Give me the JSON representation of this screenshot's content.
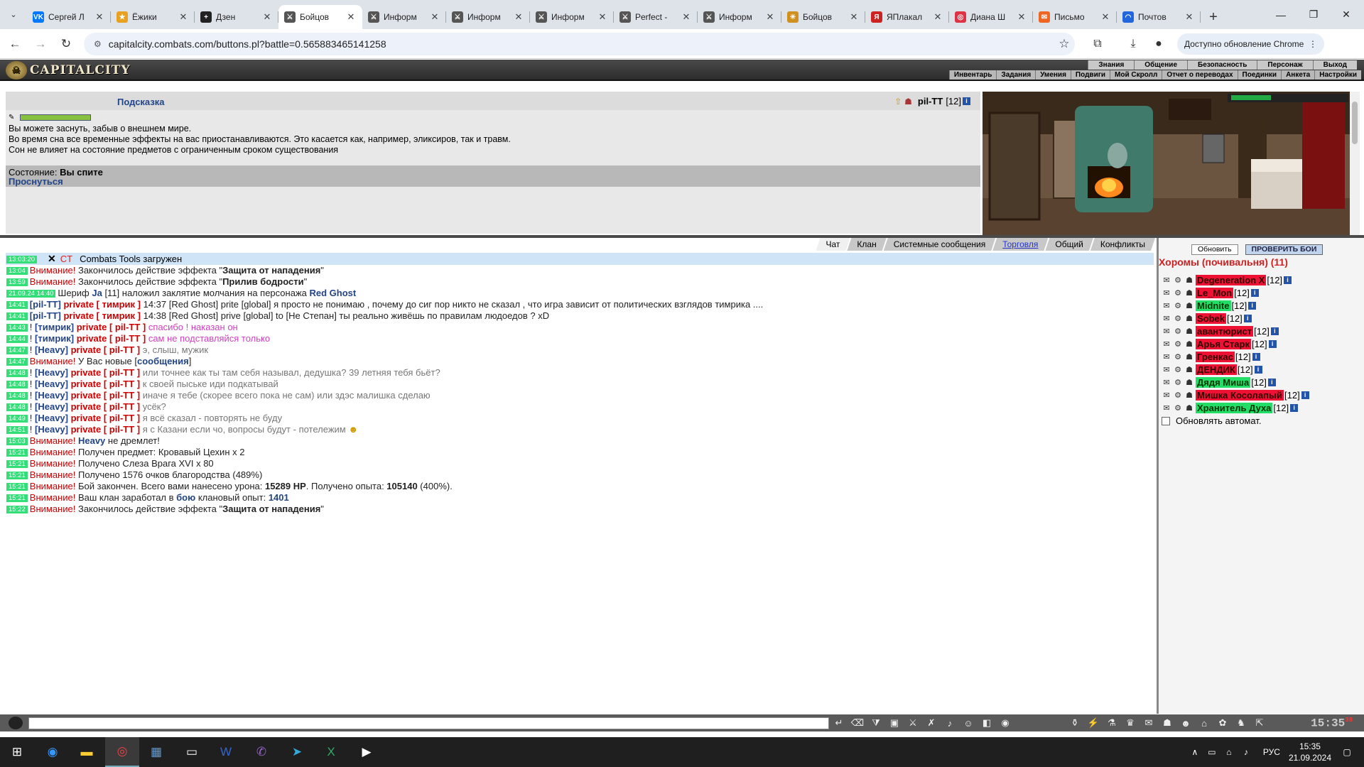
{
  "browser": {
    "tabs": [
      {
        "title": "Сергей Л",
        "icon": "VK",
        "color": "#0077ff",
        "active": false
      },
      {
        "title": "Ёжики",
        "icon": "★",
        "color": "#e8a020",
        "active": false
      },
      {
        "title": "Дзен",
        "icon": "+",
        "color": "#222222",
        "active": false
      },
      {
        "title": "Бойцов",
        "icon": "⚔",
        "color": "#555555",
        "active": true
      },
      {
        "title": "Информ",
        "icon": "⚔",
        "color": "#555555",
        "active": false
      },
      {
        "title": "Информ",
        "icon": "⚔",
        "color": "#555555",
        "active": false
      },
      {
        "title": "Информ",
        "icon": "⚔",
        "color": "#555555",
        "active": false
      },
      {
        "title": "Perfect -",
        "icon": "⚔",
        "color": "#555555",
        "active": false
      },
      {
        "title": "Информ",
        "icon": "⚔",
        "color": "#555555",
        "active": false
      },
      {
        "title": "Бойцов",
        "icon": "☀",
        "color": "#d09020",
        "active": false
      },
      {
        "title": "ЯПлакал",
        "icon": "Я",
        "color": "#cc2222",
        "active": false
      },
      {
        "title": "Диана Ш",
        "icon": "◎",
        "color": "#dd3344",
        "active": false
      },
      {
        "title": "Письмо",
        "icon": "✉",
        "color": "#ee6622",
        "active": false
      },
      {
        "title": "Почтов",
        "icon": "◠",
        "color": "#2266dd",
        "active": false
      }
    ],
    "url": "capitalcity.combats.com/buttons.pl?battle=0.565883465141258",
    "update_label": "Доступно обновление Chrome"
  },
  "game": {
    "logo_text": "CAPITALCITY",
    "nav_top": [
      "Знания",
      "Общение",
      "Безопасность",
      "Персонаж",
      "Выход"
    ],
    "nav_bottom": [
      "Инвентарь",
      "Задания",
      "Умения",
      "Подвиги",
      "Мой Скролл",
      "Отчет о переводах",
      "Поединки",
      "Анкета",
      "Настройки"
    ],
    "hint_title": "Подсказка",
    "character": {
      "name": "pil-TT",
      "level": "[12]"
    },
    "hint_lines": [
      "Вы можете заснуть, забыв о внешнем мире.",
      "Во время сна все временные эффекты на вас приостанавливаются. Это касается как, например, эликсиров, так и травм.",
      "Сон не влияет на состояние предметов с ограниченным сроком существования"
    ],
    "state_label": "Состояние:",
    "state_value": "Вы спите",
    "wake_link": "Проснуться"
  },
  "chat": {
    "tabs": [
      {
        "label": "Чат",
        "selected": true
      },
      {
        "label": "Клан",
        "selected": false
      },
      {
        "label": "Системные сообщения",
        "selected": false
      },
      {
        "label": "Торговля",
        "selected": false,
        "blue": true
      },
      {
        "label": "Общий",
        "selected": false
      },
      {
        "label": "Конфликты",
        "selected": false
      }
    ],
    "header": {
      "time": "13:03:20",
      "tag": "CT",
      "text": "Combats Tools загружен"
    },
    "lines": [
      {
        "t": "13:04",
        "parts": [
          [
            "warn",
            "Внимание! "
          ],
          [
            "dk",
            "Закончилось действие эффекта \""
          ],
          [
            "b",
            "Защита от нападения"
          ],
          [
            "dk",
            "\""
          ]
        ]
      },
      {
        "t": "13:59",
        "parts": [
          [
            "warn",
            "Внимание! "
          ],
          [
            "dk",
            "Закончилось действие эффекта \""
          ],
          [
            "b",
            "Прилив бодрости"
          ],
          [
            "dk",
            "\""
          ]
        ]
      },
      {
        "t": "21.09.24 14:40",
        "parts": [
          [
            "dk",
            "Шериф "
          ],
          [
            "nick",
            "Ja"
          ],
          [
            "dk",
            " [11] наложил заклятие молчания на персонажа "
          ],
          [
            "nick",
            "Red Ghost"
          ]
        ]
      },
      {
        "t": "14:41",
        "parts": [
          [
            "nick",
            "[pil-TT] "
          ],
          [
            "priv",
            "private [ тимрик ] "
          ],
          [
            "dk",
            "14:37 [Red Ghost] prite [global] я просто не понимаю , почему до сиг пор никто не сказал , что игра зависит от политических взглядов тимрика ...."
          ]
        ]
      },
      {
        "t": "14:41",
        "parts": [
          [
            "nick",
            "[pil-TT] "
          ],
          [
            "priv",
            "private [ тимрик ] "
          ],
          [
            "dk",
            "14:38 [Red Ghost] prive [global] to [Не Степан] ты реально живёшь по правилам людоедов ? xD"
          ]
        ]
      },
      {
        "t": "14:43",
        "parts": [
          [
            "dk",
            "! "
          ],
          [
            "nick",
            "[тимрик] "
          ],
          [
            "priv",
            "private [ pil-TT ] "
          ],
          [
            "mag",
            "спасибо ! наказан он"
          ]
        ]
      },
      {
        "t": "14:44",
        "parts": [
          [
            "dk",
            "! "
          ],
          [
            "nick",
            "[тимрик] "
          ],
          [
            "priv",
            "private [ pil-TT ] "
          ],
          [
            "mag",
            "сам не подставляйся только"
          ]
        ]
      },
      {
        "t": "14:47",
        "parts": [
          [
            "dk",
            "! "
          ],
          [
            "nick",
            "[Heavy] "
          ],
          [
            "priv",
            "private [ pil-TT ] "
          ],
          [
            "gray",
            "э, слыш, мужик"
          ]
        ]
      },
      {
        "t": "14:47",
        "parts": [
          [
            "warn",
            "Внимание! "
          ],
          [
            "dk",
            "У Вас новые ["
          ],
          [
            "nick",
            "сообщения"
          ],
          [
            "dk",
            "]"
          ]
        ]
      },
      {
        "t": "14:48",
        "parts": [
          [
            "dk",
            "! "
          ],
          [
            "nick",
            "[Heavy] "
          ],
          [
            "priv",
            "private [ pil-TT ] "
          ],
          [
            "gray",
            "или точнее как ты там себя называл, дедушка? 39 летняя тебя бьёт?"
          ]
        ]
      },
      {
        "t": "14:48",
        "parts": [
          [
            "dk",
            "! "
          ],
          [
            "nick",
            "[Heavy] "
          ],
          [
            "priv",
            "private [ pil-TT ] "
          ],
          [
            "gray",
            "к своей пыське иди подкатывай"
          ]
        ]
      },
      {
        "t": "14:48",
        "parts": [
          [
            "dk",
            "! "
          ],
          [
            "nick",
            "[Heavy] "
          ],
          [
            "priv",
            "private [ pil-TT ] "
          ],
          [
            "gray",
            "иначе я тебе (скорее всего пока не сам) или здэс малишка сделаю"
          ]
        ]
      },
      {
        "t": "14:48",
        "parts": [
          [
            "dk",
            "! "
          ],
          [
            "nick",
            "[Heavy] "
          ],
          [
            "priv",
            "private [ pil-TT ] "
          ],
          [
            "gray",
            "усёк?"
          ]
        ]
      },
      {
        "t": "14:49",
        "parts": [
          [
            "dk",
            "! "
          ],
          [
            "nick",
            "[Heavy] "
          ],
          [
            "priv",
            "private [ pil-TT ] "
          ],
          [
            "gray",
            "я всё сказал - повторять не буду"
          ]
        ]
      },
      {
        "t": "14:51",
        "parts": [
          [
            "dk",
            "! "
          ],
          [
            "nick",
            "[Heavy] "
          ],
          [
            "priv",
            "private [ pil-TT ] "
          ],
          [
            "gray",
            "я с Казани если чо, вопросы будут - потележим "
          ],
          [
            "smile",
            "☻"
          ]
        ]
      },
      {
        "t": "15:03",
        "parts": [
          [
            "warn",
            "Внимание! "
          ],
          [
            "nick",
            "Heavy"
          ],
          [
            "dk",
            " не дремлет!"
          ]
        ]
      },
      {
        "t": "15:21",
        "parts": [
          [
            "warn",
            "Внимание! "
          ],
          [
            "dk",
            "Получен предмет: Кровавый Цехин x 2"
          ]
        ]
      },
      {
        "t": "15:21",
        "parts": [
          [
            "warn",
            "Внимание! "
          ],
          [
            "dk",
            "Получено Слеза Врага XVI x 80"
          ]
        ]
      },
      {
        "t": "15:21",
        "parts": [
          [
            "warn",
            "Внимание! "
          ],
          [
            "dk",
            "Получено 1576 очков благородства (489%)"
          ]
        ]
      },
      {
        "t": "15:21",
        "parts": [
          [
            "warn",
            "Внимание! "
          ],
          [
            "dk",
            "Бой закончен. Всего вами нанесено урона: "
          ],
          [
            "b",
            "15289 HP"
          ],
          [
            "dk",
            ". Получено опыта: "
          ],
          [
            "b",
            "105140"
          ],
          [
            "dk",
            " (400%)."
          ]
        ]
      },
      {
        "t": "15:21",
        "parts": [
          [
            "warn",
            "Внимание! "
          ],
          [
            "dk",
            "Ваш клан заработал в "
          ],
          [
            "nick",
            "бою"
          ],
          [
            "dk",
            " клановый опыт: "
          ],
          [
            "nick",
            "1401"
          ]
        ]
      },
      {
        "t": "15:22",
        "parts": [
          [
            "warn",
            "Внимание! "
          ],
          [
            "dk",
            "Закончилось действие эффекта \""
          ],
          [
            "b",
            "Защита от нападения"
          ],
          [
            "dk",
            "\""
          ]
        ]
      }
    ]
  },
  "room": {
    "refresh_label": "Обновить",
    "check_label": "ПРОВЕРИТЬ БОИ",
    "title": "Хоромы (почивальня) (11)",
    "players": [
      {
        "name": "Degeneration X",
        "level": "[12]",
        "style": "red"
      },
      {
        "name": "Le_Mon",
        "level": "[12]",
        "style": "red"
      },
      {
        "name": "Midnite",
        "level": "[12]",
        "style": "grn"
      },
      {
        "name": "Sobek",
        "level": "[12]",
        "style": "red"
      },
      {
        "name": "авантюрист",
        "level": "[12]",
        "style": "red"
      },
      {
        "name": "Арья Старк",
        "level": "[12]",
        "style": "red"
      },
      {
        "name": "Гренкас",
        "level": "[12]",
        "style": "red"
      },
      {
        "name": "ДЕНДИК",
        "level": "[12]",
        "style": "red"
      },
      {
        "name": "Дядя Миша",
        "level": "[12]",
        "style": "grn"
      },
      {
        "name": "Мишка Косолапый",
        "level": "[12]",
        "style": "red"
      },
      {
        "name": "Хранитель Духа",
        "level": "[12]",
        "style": "grn"
      }
    ],
    "auto_update_label": "Обновлять автомат."
  },
  "bottom": {
    "clock": "15:35",
    "clock_sec": "38"
  },
  "taskbar": {
    "lang": "РУС",
    "time": "15:35",
    "date": "21.09.2024"
  }
}
